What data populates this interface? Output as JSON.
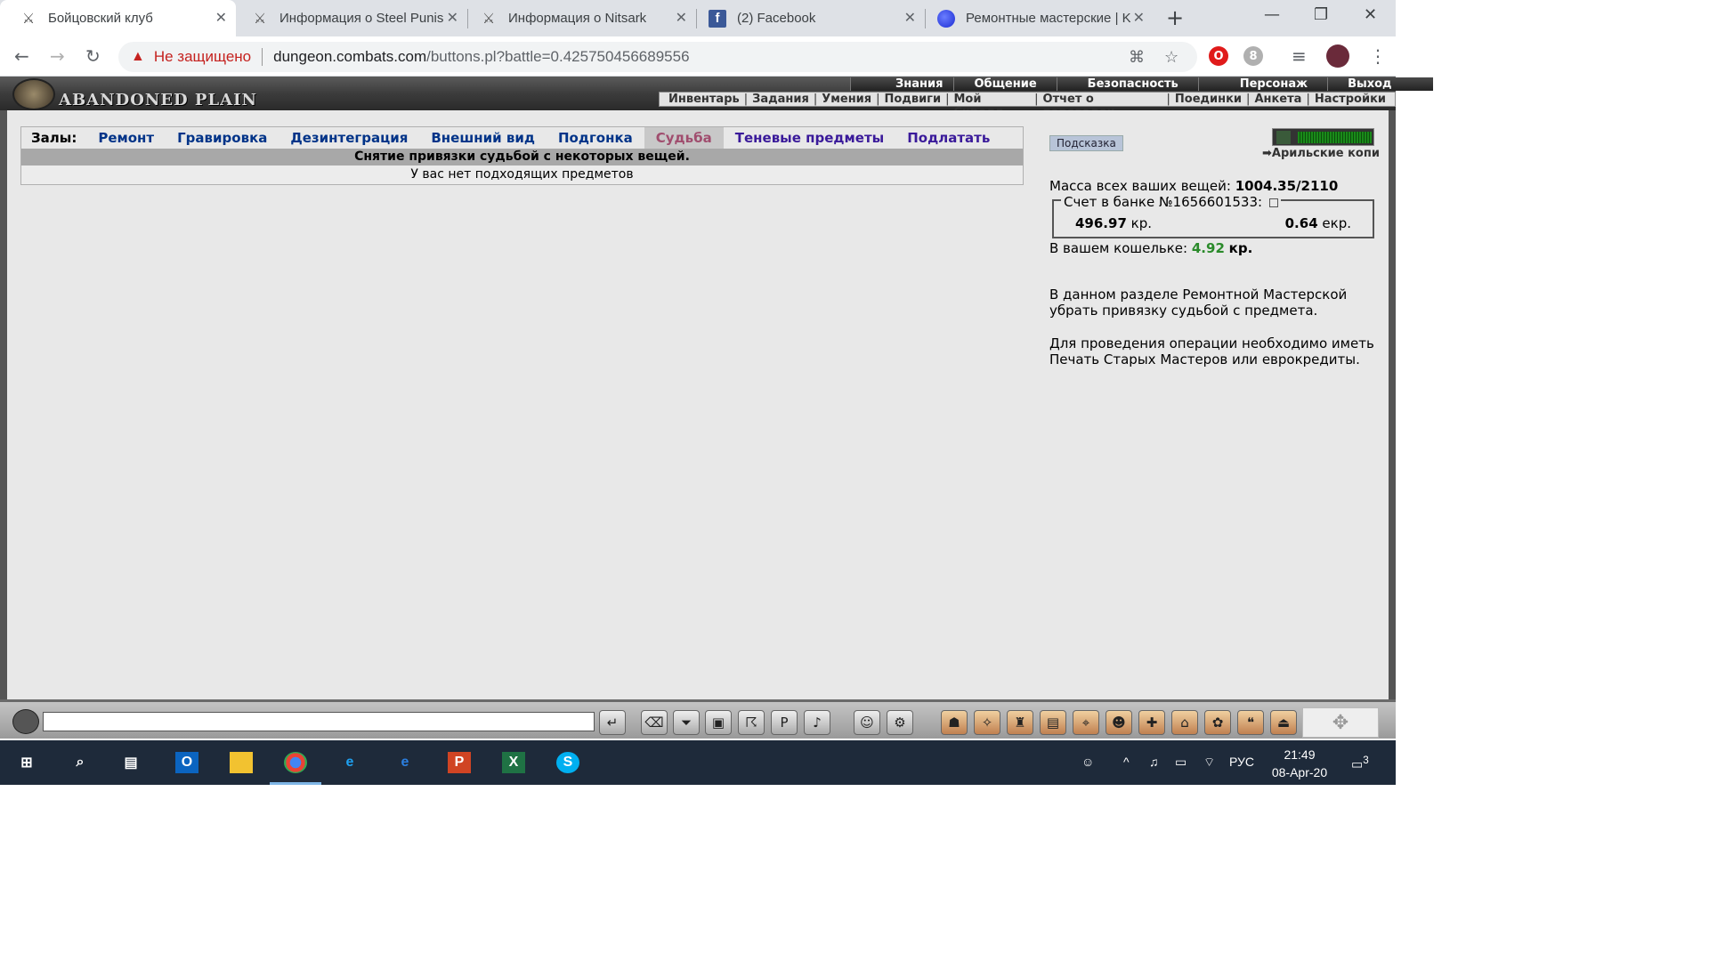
{
  "browser": {
    "tabs": [
      {
        "title": "Бойцовский клуб",
        "icon": "crossed-swords-icon",
        "active": true
      },
      {
        "title": "Информация о Steel Punish",
        "icon": "crossed-swords-icon"
      },
      {
        "title": "Информация о Nitsark",
        "icon": "crossed-swords-icon"
      },
      {
        "title": "(2) Facebook",
        "icon": "facebook-icon"
      },
      {
        "title": "Ремонтные мастерские | K",
        "icon": "globe-icon"
      }
    ],
    "security_label": "Не защищено",
    "url_host": "dungeon.combats.com",
    "url_path": "/buttons.pl?battle=0.425750456689556"
  },
  "game": {
    "logo": "ABANDONED PLAIN",
    "top_menu": [
      "Знания",
      "Общение",
      "Безопасность",
      "Персонаж",
      "Выход"
    ],
    "sub_menu": [
      "Инвентарь",
      "Задания",
      "Умения",
      "Подвиги",
      "Мой Скролл",
      "Отчет о переводах",
      "Поединки",
      "Анкета",
      "Настройки"
    ]
  },
  "halls": {
    "label": "Залы:",
    "links": [
      {
        "label": "Ремонт"
      },
      {
        "label": "Гравировка"
      },
      {
        "label": "Дезинтеграция"
      },
      {
        "label": "Внешний вид"
      },
      {
        "label": "Подгонка"
      },
      {
        "label": "Судьба",
        "current": true
      },
      {
        "label": "Теневые предметы"
      },
      {
        "label": "Подлатать"
      }
    ],
    "heading": "Снятие привязки судьбой с некоторых вещей.",
    "message": "У вас нет подходящих предметов"
  },
  "panel": {
    "hint_button": "Подсказка",
    "mine_label": "Арильские копи",
    "mass_label": "Масса всех ваших вещей:",
    "mass_value": "1004.35/2110",
    "bank_legend": "Счет в банке №1656601533:",
    "bank_kr_value": "496.97",
    "bank_kr_unit": "кр.",
    "bank_ekr_value": "0.64",
    "bank_ekr_unit": "екр.",
    "wallet_label": "В вашем кошельке:",
    "wallet_value": "4.92",
    "wallet_unit": "кр.",
    "desc1_line1": "В данном разделе Ремонтной Мастерской",
    "desc1_line2": "убрать привязку судьбой с предмета.",
    "desc2_line1": "Для проведения операции необходимо иметь",
    "desc2_line2": "Печать Старых Мастеров или еврокредиты."
  },
  "taskbar": {
    "language": "РУС",
    "time": "21:49",
    "date": "08-Apr-20",
    "notifications": "3"
  },
  "colors": {
    "accent_current_hall": "#a04d6e",
    "hall_link": "#003388",
    "wallet_green": "#2a8a2a"
  }
}
